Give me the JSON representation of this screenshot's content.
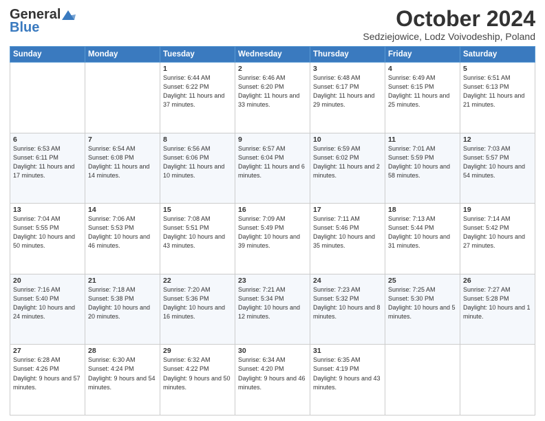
{
  "header": {
    "logo_line1": "General",
    "logo_line2": "Blue",
    "month_title": "October 2024",
    "subtitle": "Sedziejowice, Lodz Voivodeship, Poland"
  },
  "days_of_week": [
    "Sunday",
    "Monday",
    "Tuesday",
    "Wednesday",
    "Thursday",
    "Friday",
    "Saturday"
  ],
  "weeks": [
    [
      {
        "day": "",
        "info": ""
      },
      {
        "day": "",
        "info": ""
      },
      {
        "day": "1",
        "info": "Sunrise: 6:44 AM\nSunset: 6:22 PM\nDaylight: 11 hours\nand 37 minutes."
      },
      {
        "day": "2",
        "info": "Sunrise: 6:46 AM\nSunset: 6:20 PM\nDaylight: 11 hours\nand 33 minutes."
      },
      {
        "day": "3",
        "info": "Sunrise: 6:48 AM\nSunset: 6:17 PM\nDaylight: 11 hours\nand 29 minutes."
      },
      {
        "day": "4",
        "info": "Sunrise: 6:49 AM\nSunset: 6:15 PM\nDaylight: 11 hours\nand 25 minutes."
      },
      {
        "day": "5",
        "info": "Sunrise: 6:51 AM\nSunset: 6:13 PM\nDaylight: 11 hours\nand 21 minutes."
      }
    ],
    [
      {
        "day": "6",
        "info": "Sunrise: 6:53 AM\nSunset: 6:11 PM\nDaylight: 11 hours\nand 17 minutes."
      },
      {
        "day": "7",
        "info": "Sunrise: 6:54 AM\nSunset: 6:08 PM\nDaylight: 11 hours\nand 14 minutes."
      },
      {
        "day": "8",
        "info": "Sunrise: 6:56 AM\nSunset: 6:06 PM\nDaylight: 11 hours\nand 10 minutes."
      },
      {
        "day": "9",
        "info": "Sunrise: 6:57 AM\nSunset: 6:04 PM\nDaylight: 11 hours\nand 6 minutes."
      },
      {
        "day": "10",
        "info": "Sunrise: 6:59 AM\nSunset: 6:02 PM\nDaylight: 11 hours\nand 2 minutes."
      },
      {
        "day": "11",
        "info": "Sunrise: 7:01 AM\nSunset: 5:59 PM\nDaylight: 10 hours\nand 58 minutes."
      },
      {
        "day": "12",
        "info": "Sunrise: 7:03 AM\nSunset: 5:57 PM\nDaylight: 10 hours\nand 54 minutes."
      }
    ],
    [
      {
        "day": "13",
        "info": "Sunrise: 7:04 AM\nSunset: 5:55 PM\nDaylight: 10 hours\nand 50 minutes."
      },
      {
        "day": "14",
        "info": "Sunrise: 7:06 AM\nSunset: 5:53 PM\nDaylight: 10 hours\nand 46 minutes."
      },
      {
        "day": "15",
        "info": "Sunrise: 7:08 AM\nSunset: 5:51 PM\nDaylight: 10 hours\nand 43 minutes."
      },
      {
        "day": "16",
        "info": "Sunrise: 7:09 AM\nSunset: 5:49 PM\nDaylight: 10 hours\nand 39 minutes."
      },
      {
        "day": "17",
        "info": "Sunrise: 7:11 AM\nSunset: 5:46 PM\nDaylight: 10 hours\nand 35 minutes."
      },
      {
        "day": "18",
        "info": "Sunrise: 7:13 AM\nSunset: 5:44 PM\nDaylight: 10 hours\nand 31 minutes."
      },
      {
        "day": "19",
        "info": "Sunrise: 7:14 AM\nSunset: 5:42 PM\nDaylight: 10 hours\nand 27 minutes."
      }
    ],
    [
      {
        "day": "20",
        "info": "Sunrise: 7:16 AM\nSunset: 5:40 PM\nDaylight: 10 hours\nand 24 minutes."
      },
      {
        "day": "21",
        "info": "Sunrise: 7:18 AM\nSunset: 5:38 PM\nDaylight: 10 hours\nand 20 minutes."
      },
      {
        "day": "22",
        "info": "Sunrise: 7:20 AM\nSunset: 5:36 PM\nDaylight: 10 hours\nand 16 minutes."
      },
      {
        "day": "23",
        "info": "Sunrise: 7:21 AM\nSunset: 5:34 PM\nDaylight: 10 hours\nand 12 minutes."
      },
      {
        "day": "24",
        "info": "Sunrise: 7:23 AM\nSunset: 5:32 PM\nDaylight: 10 hours\nand 8 minutes."
      },
      {
        "day": "25",
        "info": "Sunrise: 7:25 AM\nSunset: 5:30 PM\nDaylight: 10 hours\nand 5 minutes."
      },
      {
        "day": "26",
        "info": "Sunrise: 7:27 AM\nSunset: 5:28 PM\nDaylight: 10 hours\nand 1 minute."
      }
    ],
    [
      {
        "day": "27",
        "info": "Sunrise: 6:28 AM\nSunset: 4:26 PM\nDaylight: 9 hours\nand 57 minutes."
      },
      {
        "day": "28",
        "info": "Sunrise: 6:30 AM\nSunset: 4:24 PM\nDaylight: 9 hours\nand 54 minutes."
      },
      {
        "day": "29",
        "info": "Sunrise: 6:32 AM\nSunset: 4:22 PM\nDaylight: 9 hours\nand 50 minutes."
      },
      {
        "day": "30",
        "info": "Sunrise: 6:34 AM\nSunset: 4:20 PM\nDaylight: 9 hours\nand 46 minutes."
      },
      {
        "day": "31",
        "info": "Sunrise: 6:35 AM\nSunset: 4:19 PM\nDaylight: 9 hours\nand 43 minutes."
      },
      {
        "day": "",
        "info": ""
      },
      {
        "day": "",
        "info": ""
      }
    ]
  ]
}
